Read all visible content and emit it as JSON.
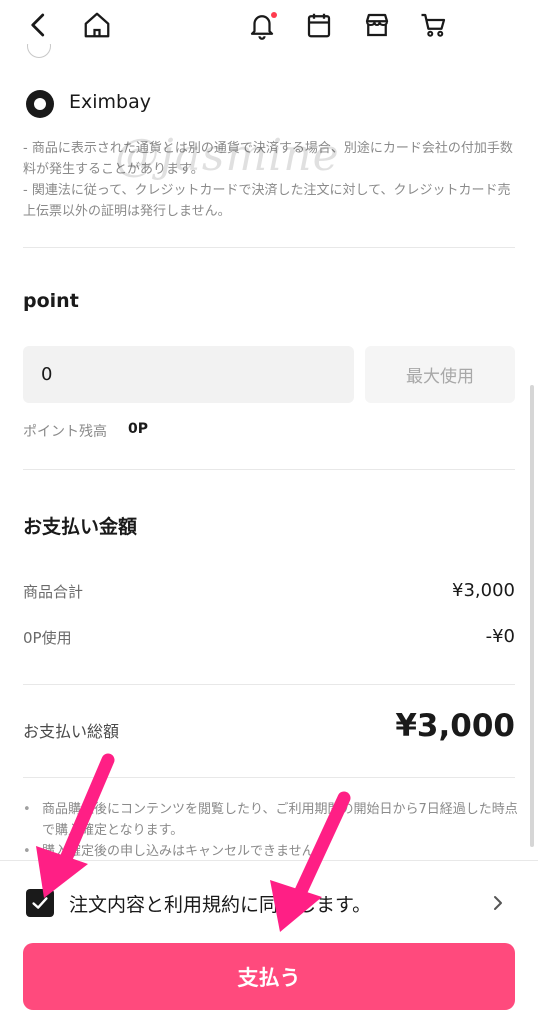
{
  "nav": {
    "icons": [
      "back-icon",
      "home-icon",
      "bell-icon",
      "calendar-icon",
      "store-icon",
      "cart-icon"
    ],
    "notification_dot_color": "#ff3b4e"
  },
  "payment_method": {
    "selected_label": "Eximbay"
  },
  "notes": [
    "- 商品に表示された通貨とは別の通貨で決済する場合、別途にカード会社の付加手数料が発生することがあります。",
    "- 関連法に従って、クレジットカードで決済した注文に対して、クレジットカード売上伝票以外の証明は発行しません。"
  ],
  "watermark": "@jasmine",
  "point": {
    "title": "point",
    "input_value": "0",
    "max_button": "最大使用",
    "balance_label": "ポイント残高",
    "balance_value": "0P"
  },
  "summary": {
    "title": "お支払い金額",
    "subtotal_label": "商品合計",
    "subtotal_value": "¥3,000",
    "points_used_label": "0P使用",
    "points_used_value": "-¥0",
    "total_label": "お支払い総額",
    "total_value": "¥3,000"
  },
  "bullets": [
    "商品購入後にコンテンツを閲覧したり、ご利用期間の開始日から7日経過した時点で購入確定となります。",
    "購入確定後の申し込みはキャンセルできません。"
  ],
  "footer": {
    "agree_text": "注文内容と利用規約に同意します。",
    "agree_checked": true,
    "pay_button": "支払う",
    "pay_color": "#ff4a7d"
  },
  "annotation_color": "#ff1f85"
}
